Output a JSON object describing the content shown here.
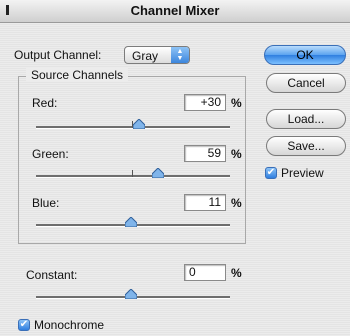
{
  "window": {
    "title": "Channel Mixer"
  },
  "output_channel": {
    "label": "Output Channel:",
    "value": "Gray"
  },
  "source_channels": {
    "title": "Source Channels",
    "red": {
      "label": "Red:",
      "value": "+30",
      "unit": "%",
      "level": 0.53
    },
    "green": {
      "label": "Green:",
      "value": "59",
      "unit": "%",
      "level": 0.63
    },
    "blue": {
      "label": "Blue:",
      "value": "11",
      "unit": "%",
      "level": 0.49
    }
  },
  "constant": {
    "label": "Constant:",
    "value": "0",
    "unit": "%",
    "level": 0.49
  },
  "buttons": {
    "ok": "OK",
    "cancel": "Cancel",
    "load": "Load...",
    "save": "Save..."
  },
  "preview": {
    "label": "Preview",
    "checked": true
  },
  "monochrome": {
    "label": "Monochrome",
    "checked": true
  }
}
